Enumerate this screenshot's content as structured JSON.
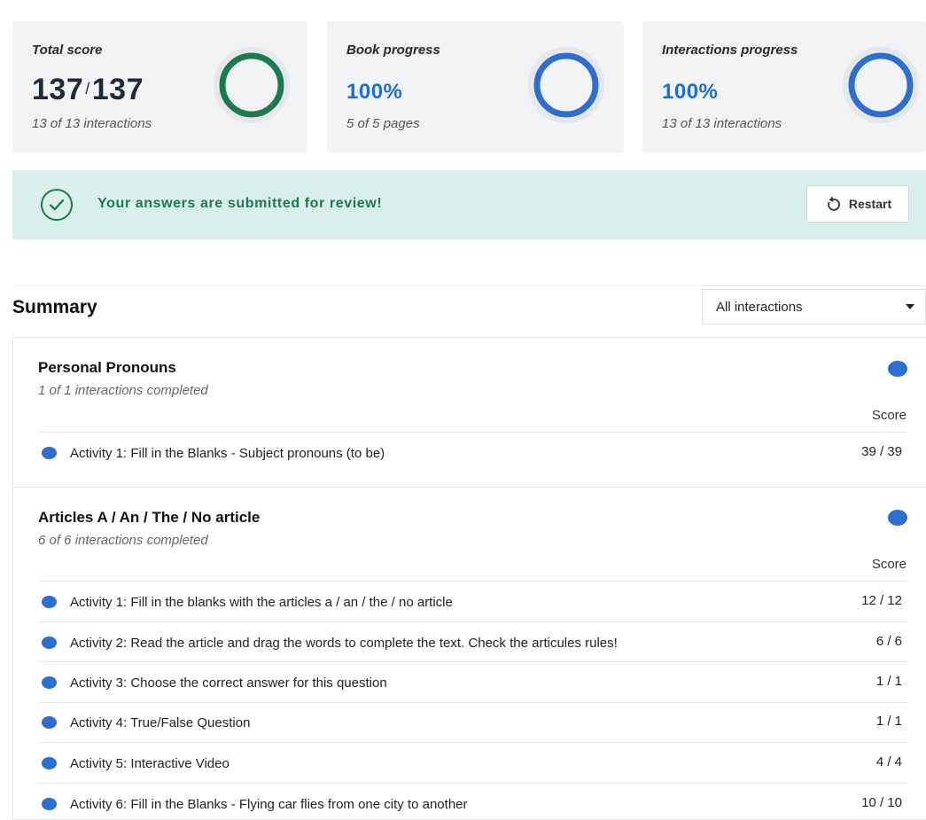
{
  "cards": {
    "total": {
      "title": "Total score",
      "score": "137",
      "separator": "/",
      "max": "137",
      "sub": "13 of 13 interactions",
      "progress": 1.0,
      "color": "#1b7a4e"
    },
    "book": {
      "title": "Book progress",
      "value": "100%",
      "sub": "5 of 5 pages",
      "progress": 1.0,
      "color": "#2c6fd1"
    },
    "interactions": {
      "title": "Interactions progress",
      "value": "100%",
      "sub": "13 of 13 interactions",
      "progress": 1.0,
      "color": "#2c6fd1"
    }
  },
  "banner": {
    "message": "Your answers are submitted for review!",
    "restart_label": "Restart",
    "icon": "check-circle-icon",
    "accent": "#1a7a4b",
    "background": "#d9efec"
  },
  "summary": {
    "title": "Summary",
    "filter_selected": "All interactions",
    "score_label": "Score",
    "sections": [
      {
        "title": "Personal Pronouns",
        "completed": "1 of 1 interactions completed",
        "activities": [
          {
            "label": "Activity 1: Fill in the Blanks - Subject pronouns (to be)",
            "score": "39 / 39"
          }
        ]
      },
      {
        "title": "Articles A / An / The / No article",
        "completed": "6 of 6 interactions completed",
        "activities": [
          {
            "label": "Activity 1: Fill in the blanks with the articles a / an / the / no article",
            "score": "12 / 12"
          },
          {
            "label": "Activity 2: Read the article and drag the words to complete the text. Check the articules rules!",
            "score": "6 / 6"
          },
          {
            "label": "Activity 3: Choose the correct answer for this question",
            "score": "1 / 1"
          },
          {
            "label": "Activity 4: True/False Question",
            "score": "1 / 1"
          },
          {
            "label": "Activity 5: Interactive Video",
            "score": "4 / 4"
          },
          {
            "label": "Activity 6: Fill in the Blanks - Flying car flies from one city to another",
            "score": "10 / 10"
          }
        ]
      }
    ]
  }
}
